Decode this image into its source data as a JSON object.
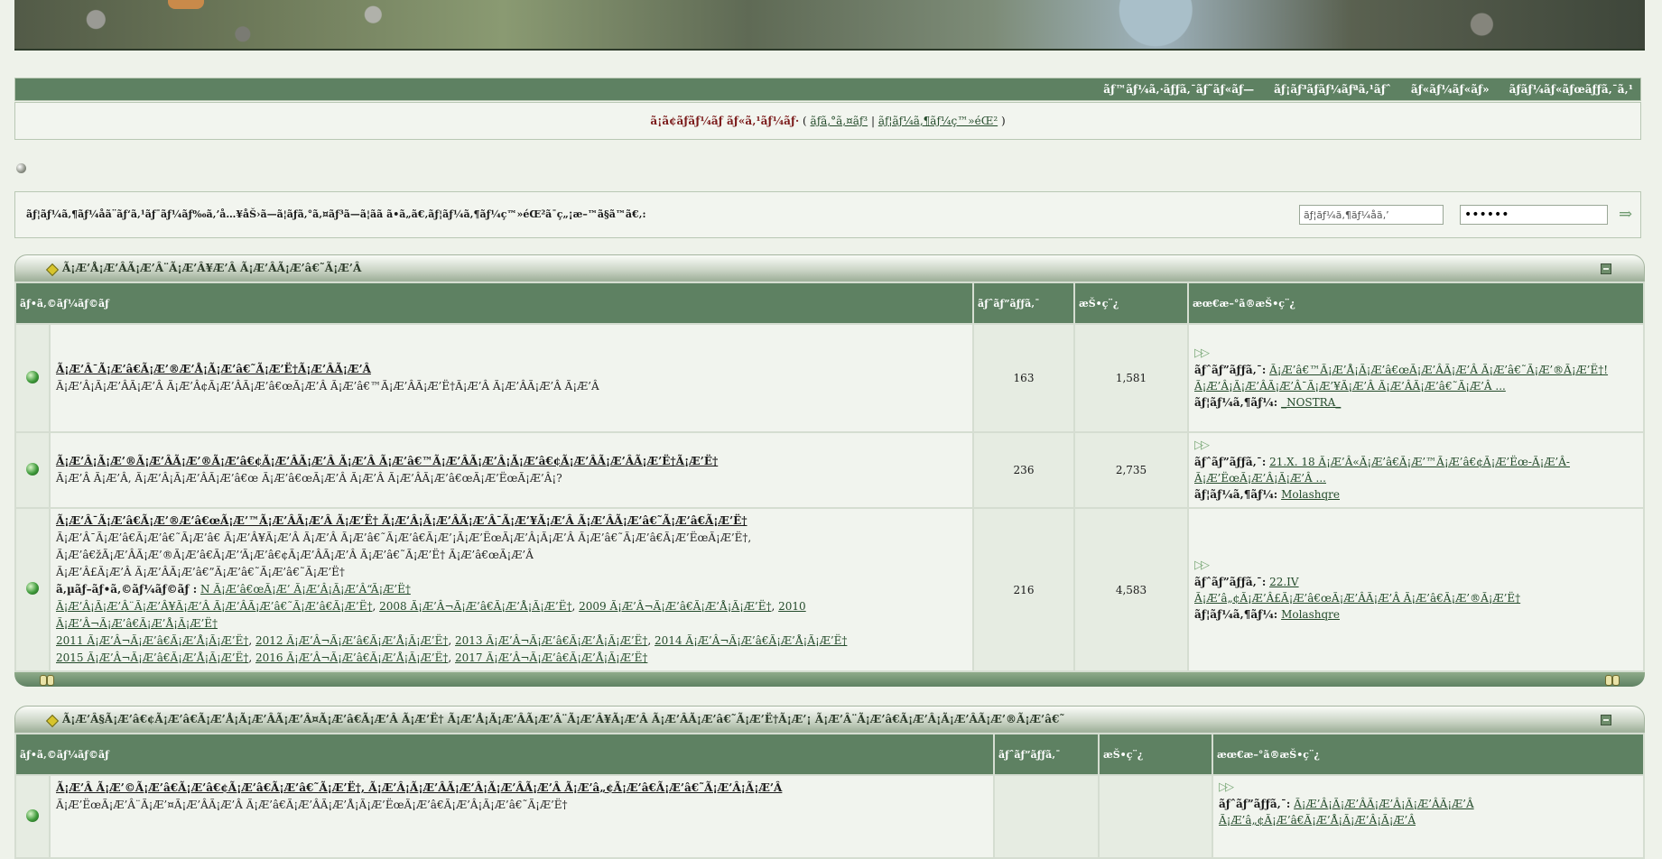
{
  "topnav": {
    "items": [
      "ãƒ™ãƒ¼ã‚·ãƒƒã‚¯ãƒ˜ãƒ«ãƒ—",
      "ãƒ¡ãƒ³ãƒãƒ¼ãƒªã‚¹ãƒˆ",
      "ãƒ«ãƒ¼ãƒ«ãƒ»",
      "ãƒãƒ¼ãƒ«ãƒœãƒƒã‚¯ã‚¹"
    ]
  },
  "welcome": {
    "greeting": "ã¡ã¢ãƒ­ãƒ¼ãƒ ãƒ«ã‚¹ãƒ¼ãƒ·",
    "open_paren": "(",
    "login_link": "ãƒ­ã‚°ã‚¤ãƒ³",
    "sep": "|",
    "register_link": "ãƒ¦ãƒ¼ã‚¶ãƒ¼ç™»éŒ²",
    "close_paren": ")"
  },
  "login": {
    "label": "ãƒ¦ãƒ¼ã‚¶ãƒ¼åã¨ãƒ‘ã‚¹ãƒ¯ãƒ¼ãƒ‰ã‚’å…¥åŠ›ã—ã¦ãƒ­ã‚°ã‚¤ãƒ³ã—ã¦ãã ã•ã„ã€‚ãƒ¦ãƒ¼ã‚¶ãƒ¼ç™»éŒ²ã¯ç„¡æ–™ã§ã™ã€‚:",
    "username_value": "ãƒ¦ãƒ¼ã‚¶ãƒ¼åã‚’",
    "password_value": "••••••",
    "go_icon": "submit-arrow-icon"
  },
  "categories": [
    {
      "title": "Ã¡Æ’Å¡Æ’ÂÃ¡Æ’Â¨Ã¡Æ’Â¥Æ’Â Ã¡Æ’ÂÃ¡Æ’â€˜Ã¡Æ’Â",
      "headers": [
        "ãƒ•ã‚©ãƒ¼ãƒ©ãƒ ",
        "ãƒˆãƒ”ãƒƒã‚¯",
        "æŠ•ç¨¿",
        "æœ€æ–°ã®æŠ•ç¨¿"
      ],
      "forums": [
        {
          "title": "Ã¡Æ’Â¯Ã¡Æ’â€Ã¡Æ’®Æ’Å¡Ã¡Æ’â€˜Ã¡Æ’Ë†Ã¡Æ’ÂÃ¡Æ’Â",
          "desc": "Ã¡Æ’Â¡Ã¡Æ’ÂÃ¡Æ’Â Ã¡Æ’Â¢Ã¡Æ’ÂÃ¡Æ’â€œÃ¡Æ’Â Ã¡Æ’â€™Ã¡Æ’ÂÃ¡Æ’Ë†Ã¡Æ’Â Ã¡Æ’ÂÃ¡Æ’Â Ã¡Æ’Â",
          "topics": "163",
          "posts": "1,581",
          "last_label": "ãƒˆãƒ”ãƒƒã‚¯:",
          "last_title": "Ã¡Æ’â€™Ã¡Æ’Å¡Ã¡Æ’â€œÃ¡Æ’ÂÃ¡Æ’Â Ã¡Æ’â€˜Ã¡Æ’®Ã¡Æ’Ë†! Ã¡Æ’Â¡Ã¡Æ’ÂÃ¡Æ’Â¯Ã¡Æ’¥Ã¡Æ’Â Ã¡Æ’ÂÃ¡Æ’â€˜Ã¡Æ’Â ...",
          "by_label": "ãƒ¦ãƒ¼ã‚¶ãƒ¼:",
          "last_user": "_NOSTRA_"
        },
        {
          "title": "Ã¡Æ’Â¡Ã¡Æ’®Ã¡Æ’ÂÃ¡Æ’®Ã¡Æ’â€¢Ã¡Æ’ÂÃ¡Æ’Â Ã¡Æ’Â Ã¡Æ’â€™Ã¡Æ’ÂÃ¡Æ’Â¡Ã¡Æ’â€¢Ã¡Æ’ÂÃ¡Æ’ÂÃ¡Æ’Ë†Ã¡Æ’Ë†",
          "desc": "Ã¡Æ’Â Ã¡Æ’Â, Ã¡Æ’Â¡Ã¡Æ’ÂÃ¡Æ’â€œ Ã¡Æ’â€œÃ¡Æ’Â Ã¡Æ’Â Ã¡Æ’ÂÃ¡Æ’â€œÃ¡Æ’ËœÃ¡Æ’Â¡?",
          "topics": "236",
          "posts": "2,735",
          "last_label": "ãƒˆãƒ”ãƒƒã‚¯:",
          "last_title": "21.X. 18 Ã¡Æ’Â«Ã¡Æ’â€Ã¡Æ’™Ã¡Æ’â€¢Ã¡Æ’Ëœ-Ã¡Æ’Â-Ã¡Æ’ËœÃ¡Æ’Â¡Ã¡Æ’Â ...",
          "by_label": "ãƒ¦ãƒ¼ã‚¶ãƒ¼:",
          "last_user": "Molashqre"
        },
        {
          "title": "Ã¡Æ’Â¯Ã¡Æ’â€Ã¡Æ’®Æ’â€œÃ¡Æ’™Ã¡Æ’ÂÃ¡Æ’Â Ã¡Æ’Ë† Ã¡Æ’Â¡Ã¡Æ’ÂÃ¡Æ’Â¯Ã¡Æ’¥Ã¡Æ’Â Ã¡Æ’ÂÃ¡Æ’â€˜Ã¡Æ’â€Ã¡Æ’Ë†",
          "desc_lines": [
            "Ã¡Æ’Â¯Ã¡Æ’â€Ã¡Æ’â€˜Ã¡Æ’â€ Ã¡Æ’Â¥Ã¡Æ’Â Ã¡Æ’Â Ã¡Æ’â€˜Ã¡Æ’â€Ã¡Æ’¡Ã¡Æ’ËœÃ¡Æ’Â¡Ã¡Æ’Â Ã¡Æ’â€˜Ã¡Æ’â€Ã¡Æ’ËœÃ¡Æ’Ë†,",
            "Ã¡Æ’â€žÃ¡Æ’ÂÃ¡Æ’®Ã¡Æ’â€Ã¡Æ’‘Ã¡Æ’â€¢Ã¡Æ’ÂÃ¡Æ’Â Ã¡Æ’â€˜Ã¡Æ’Ë† Ã¡Æ’â€œÃ¡Æ’Â",
            "Ã¡Æ’Â£Ã¡Æ’Â Ã¡Æ’ÂÃ¡Æ’â€”Ã¡Æ’â€˜Ã¡Æ’â€˜Ã¡Æ’Ë†"
          ],
          "sub_label": "ã‚µãƒ–ãƒ•ã‚©ãƒ¼ãƒ©ãƒ :",
          "subforums": [
            "N Ã¡Æ’â€œÃ¡Æ’ Ã¡Æ’Â¡Ã¡Æ’Â“Ã¡Æ’Ë†",
            "Ã¡Æ’Â¡Ã¡Æ’Â¨Ã¡Æ’Â¥Ã¡Æ’Â Ã¡Æ’ÂÃ¡Æ’â€˜Ã¡Æ’â€Ã¡Æ’Ë†",
            "2008 Ã¡Æ’Â¬Ã¡Æ’â€Ã¡Æ’Å¡Ã¡Æ’Ë†",
            "2009 Ã¡Æ’Â¬Ã¡Æ’â€Ã¡Æ’Å¡Ã¡Æ’Ë†",
            "2010 Ã¡Æ’Â¬Ã¡Æ’â€Ã¡Æ’Å¡Ã¡Æ’Ë†",
            "2011 Ã¡Æ’Â¬Ã¡Æ’â€Ã¡Æ’Å¡Ã¡Æ’Ë†",
            "2012 Ã¡Æ’Â¬Ã¡Æ’â€Ã¡Æ’Å¡Ã¡Æ’Ë†",
            "2013 Ã¡Æ’Â¬Ã¡Æ’â€Ã¡Æ’Å¡Ã¡Æ’Ë†",
            "2014 Ã¡Æ’Â¬Ã¡Æ’â€Ã¡Æ’Å¡Ã¡Æ’Ë†",
            "2015 Ã¡Æ’Â¬Ã¡Æ’â€Ã¡Æ’Å¡Ã¡Æ’Ë†",
            "2016 Ã¡Æ’Â¬Ã¡Æ’â€Ã¡Æ’Å¡Ã¡Æ’Ë†",
            "2017 Ã¡Æ’Â¬Ã¡Æ’â€Ã¡Æ’Å¡Ã¡Æ’Ë†"
          ],
          "topics": "216",
          "posts": "4,583",
          "last_label": "ãƒˆãƒ”ãƒƒã‚¯:",
          "last_title": "22.IV",
          "last_title2": "Ã¡Æ’â„¢Ã¡Æ’Â£Ã¡Æ’â€œÃ¡Æ’ÂÃ¡Æ’Â Ã¡Æ’â€Ã¡Æ’®Ã¡Æ’Ë†",
          "by_label": "ãƒ¦ãƒ¼ã‚¶ãƒ¼:",
          "last_user": "Molashqre"
        }
      ]
    },
    {
      "title": "Ã¡Æ’Â§Ã¡Æ’â€¢Ã¡Æ’â€Ã¡Æ’Å¡Ã¡Æ’ÂÃ¡Æ’Â¤Ã¡Æ’â€Ã¡Æ’Â Ã¡Æ’Ë† Ã¡Æ’Å¡Ã¡Æ’ÂÃ¡Æ’Â¨Ã¡Æ’Â¥Ã¡Æ’Â Ã¡Æ’ÂÃ¡Æ’â€˜Ã¡Æ’Ë†Ã¡Æ’¡ Ã¡Æ’Â¨Ã¡Æ’â€Ã¡Æ’Â¡Ã¡Æ’ÂÃ¡Æ’®Ã¡Æ’â€˜",
      "headers": [
        "ãƒ•ã‚©ãƒ¼ãƒ©ãƒ ",
        "ãƒˆãƒ”ãƒƒã‚¯",
        "æŠ•ç¨¿",
        "æœ€æ–°ã®æŠ•ç¨¿"
      ],
      "forums": [
        {
          "title": "Ã¡Æ’Â Ã¡Æ’©Ã¡Æ’â€Ã¡Æ’â€¢Ã¡Æ’â€Ã¡Æ’â€˜Ã¡Æ’Ë†, Ã¡Æ’Â¡Ã¡Æ’ÂÃ¡Æ’Â¡Ã¡Æ’ÂÃ¡Æ’Â Ã¡Æ’â„¢Ã¡Æ’â€Ã¡Æ’â€˜Ã¡Æ’Â¡Ã¡Æ’Â",
          "desc": "Ã¡Æ’ËœÃ¡Æ’Â¨Ã¡Æ’¤Ã¡Æ’ÂÃ¡Æ’Â Ã¡Æ’â€Ã¡Æ’ÂÃ¡Æ’Å¡Ã¡Æ’ËœÃ¡Æ’â€Ã¡Æ’Â¡Ã¡Æ’â€˜Ã¡Æ’Ë†",
          "last_label": "ãƒˆãƒ”ãƒƒã‚¯:",
          "last_title": "Ã¡Æ’Â¡Ã¡Æ’ÂÃ¡Æ’Â¡Ã¡Æ’ÂÃ¡Æ’Â Ã¡Æ’â„¢Ã¡Æ’â€Ã¡Æ’Å¡Ã¡Æ’Â¡Ã¡Æ’Â"
        }
      ]
    }
  ]
}
